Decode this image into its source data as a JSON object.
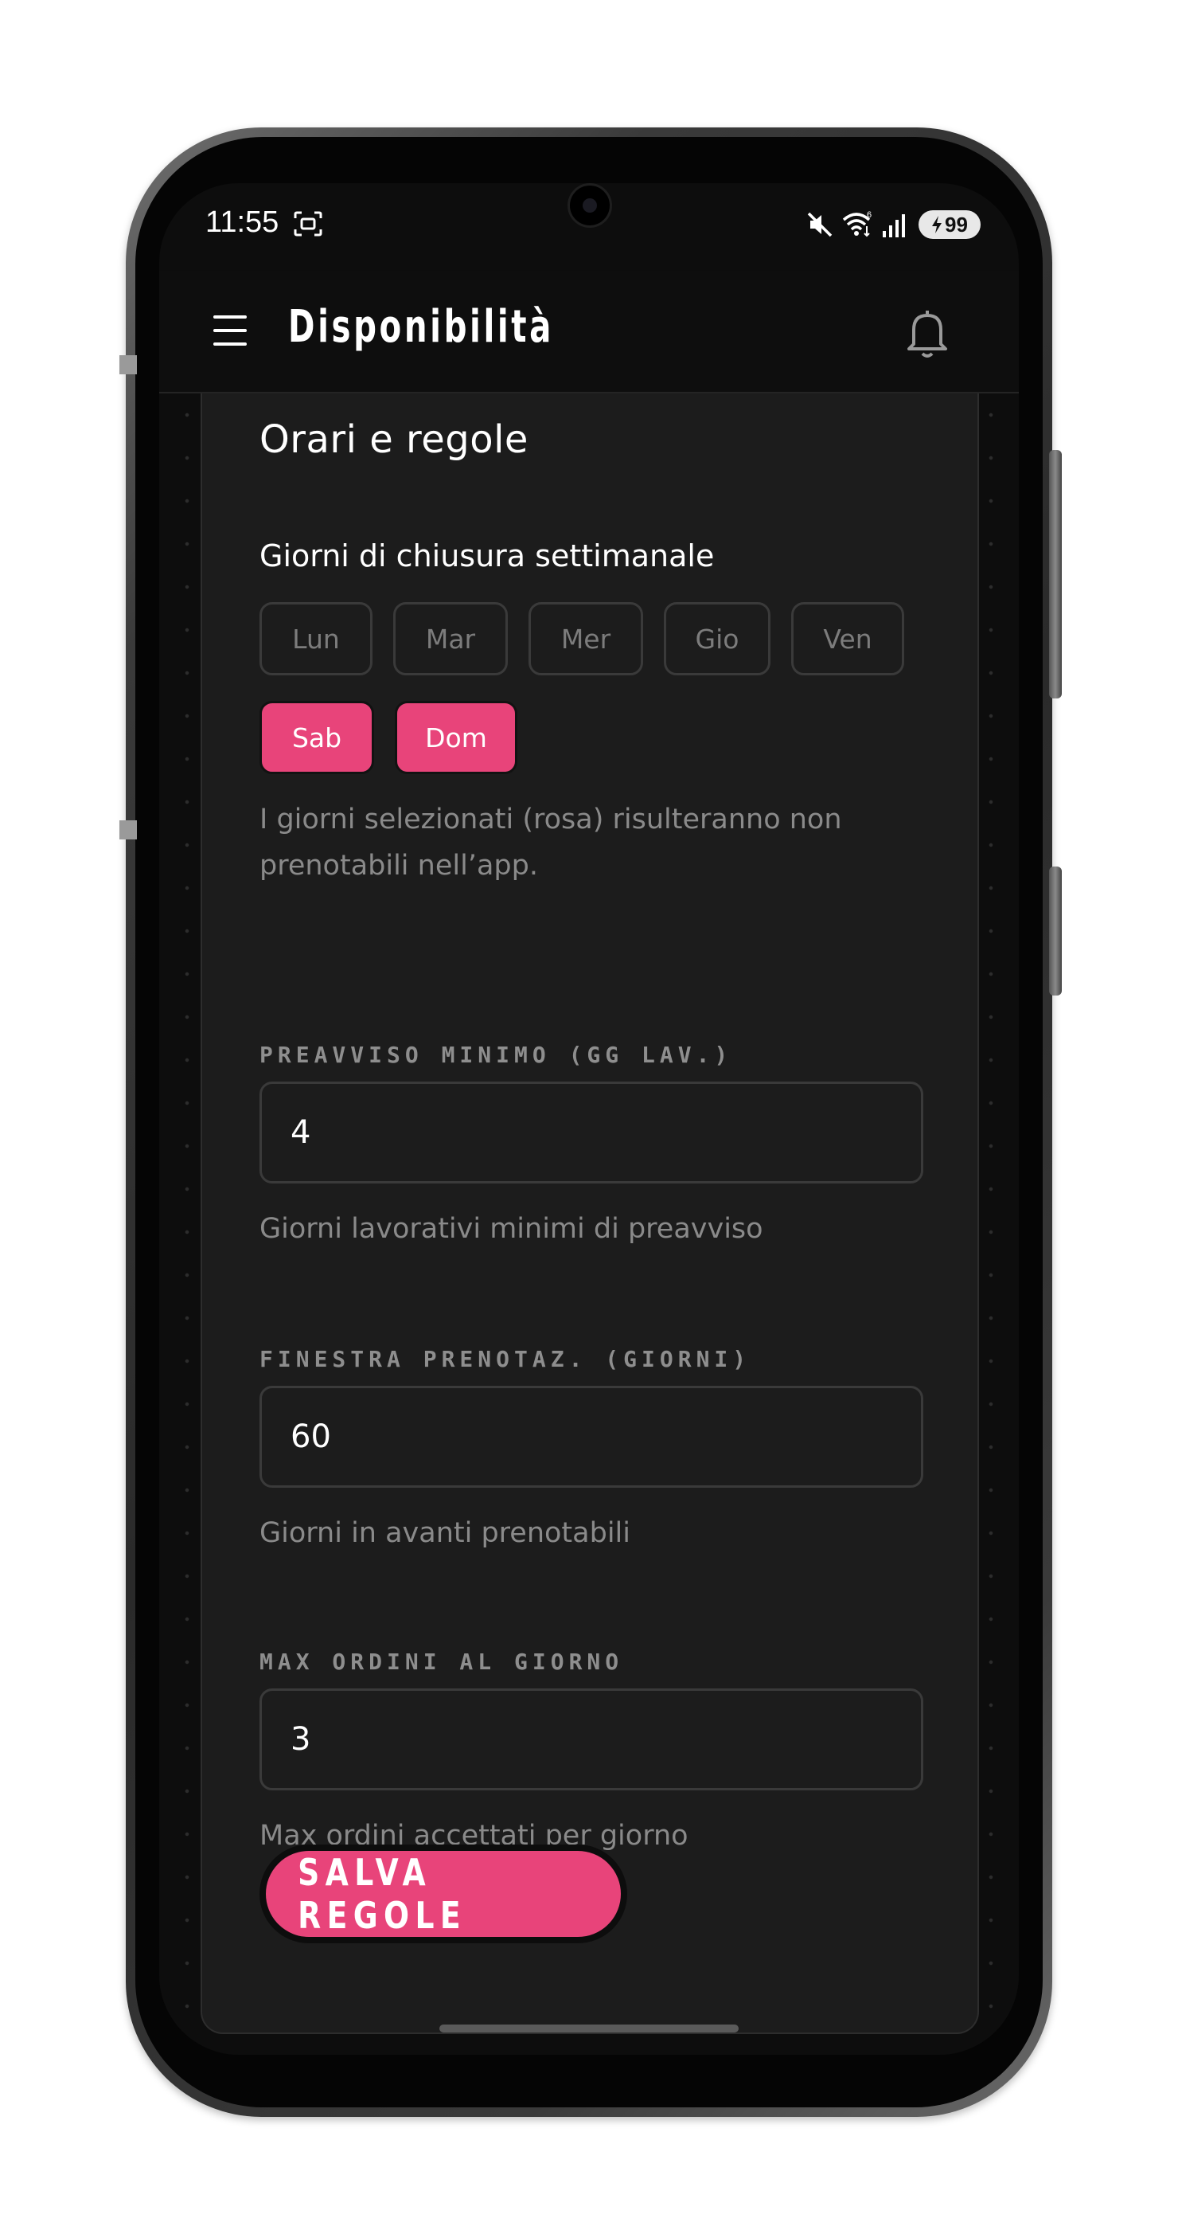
{
  "status_bar": {
    "time": "11:55",
    "battery": "99",
    "wifi_badge": "6"
  },
  "app_bar": {
    "title": "Disponibilità"
  },
  "card": {
    "title": "Orari e regole",
    "closing_days": {
      "label": "Giorni di chiusura settimanale",
      "days": [
        {
          "label": "Lun",
          "selected": false
        },
        {
          "label": "Mar",
          "selected": false
        },
        {
          "label": "Mer",
          "selected": false
        },
        {
          "label": "Gio",
          "selected": false
        },
        {
          "label": "Ven",
          "selected": false
        },
        {
          "label": "Sab",
          "selected": true
        },
        {
          "label": "Dom",
          "selected": true
        }
      ],
      "helper": "I giorni selezionati (rosa) risulteranno non prenotabili nell’app."
    },
    "min_notice": {
      "label": "PREAVVISO MINIMO (GG LAV.)",
      "value": "4",
      "helper": "Giorni lavorativi minimi di preavviso"
    },
    "booking_window": {
      "label": "FINESTRA PRENOTAZ. (GIORNI)",
      "value": "60",
      "helper": "Giorni in avanti prenotabili"
    },
    "max_orders": {
      "label": "MAX ORDINI AL GIORNO",
      "value": "3",
      "helper": "Max ordini accettati per giorno"
    },
    "save_label": "SALVA REGOLE"
  },
  "colors": {
    "accent": "#e8447a",
    "card_bg": "#1c1c1c",
    "screen_bg": "#0d0d0d"
  },
  "icons": [
    "menu-icon",
    "bell-icon",
    "mute-icon",
    "wifi-icon",
    "signal-icon",
    "battery-icon",
    "screenshot-icon"
  ]
}
